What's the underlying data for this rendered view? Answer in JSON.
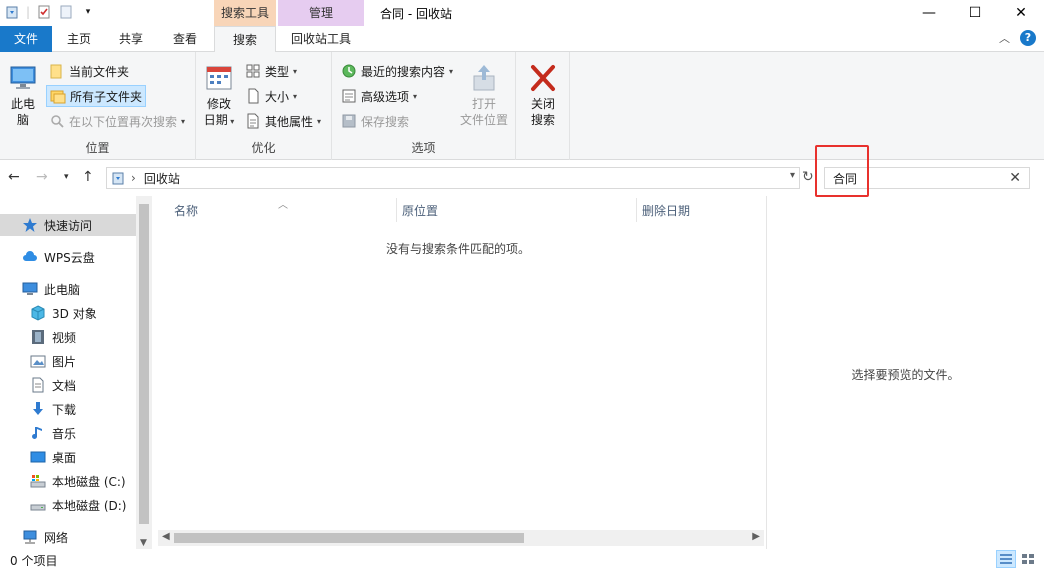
{
  "window": {
    "title": "合同 - 回收站",
    "context_tab_search": "搜索工具",
    "context_tab_manage": "管理",
    "minimize": "—",
    "maximize": "☐",
    "close": "✕"
  },
  "tabs": {
    "file": "文件",
    "home": "主页",
    "share": "共享",
    "view": "查看",
    "search": "搜索",
    "recycle": "回收站工具"
  },
  "ribbon": {
    "location": {
      "label": "位置",
      "this_pc": "此电脑",
      "this_pc_line1": "此电",
      "this_pc_line2": "脑",
      "current_folder": "当前文件夹",
      "all_subfolders": "所有子文件夹",
      "search_again": "在以下位置再次搜索"
    },
    "refine": {
      "label": "优化",
      "date_modified_1": "修改",
      "date_modified_2": "日期",
      "kind": "类型",
      "size": "大小",
      "other_props": "其他属性"
    },
    "options": {
      "label": "选项",
      "recent_searches": "最近的搜索内容",
      "advanced": "高级选项",
      "save_search": "保存搜索",
      "open_location_1": "打开",
      "open_location_2": "文件位置"
    },
    "close_search": {
      "line1": "关闭",
      "line2": "搜索"
    }
  },
  "address": {
    "crumb": "回收站",
    "search_value": "合同"
  },
  "nav": {
    "quick_access": "快速访问",
    "wps_cloud": "WPS云盘",
    "this_pc": "此电脑",
    "objects3d": "3D 对象",
    "videos": "视频",
    "pictures": "图片",
    "documents": "文档",
    "downloads": "下载",
    "music": "音乐",
    "desktop": "桌面",
    "disk_c": "本地磁盘 (C:)",
    "disk_d": "本地磁盘 (D:)",
    "network": "网络"
  },
  "filelist": {
    "col_name": "名称",
    "col_origin": "原位置",
    "col_deleted": "删除日期",
    "empty": "没有与搜索条件匹配的项。"
  },
  "preview": {
    "message": "选择要预览的文件。"
  },
  "status": {
    "count": "0 个项目"
  },
  "colors": {
    "accent": "#1979ca",
    "highlight": "#e8312d",
    "search_tab": "#f8d5b8",
    "manage_tab": "#e6ccf0"
  }
}
